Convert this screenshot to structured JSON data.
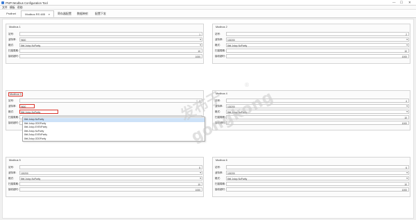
{
  "window": {
    "title": "PNPI Modbus Configuration Tool",
    "minimize": "—",
    "maximize": "☐",
    "close": "✕"
  },
  "menu": [
    "文件",
    "模板",
    "帮助"
  ],
  "tabs": [
    {
      "label": "Profinet"
    },
    {
      "label": "Modbus RS 485"
    },
    {
      "label": "寄存器配置"
    },
    {
      "label": "数据映射"
    },
    {
      "label": "配置下发"
    }
  ],
  "labels": {
    "station": "站号:",
    "baud": "波特率:",
    "format": "格式:",
    "scan": "扫描周期:",
    "timeout": "接收超时:"
  },
  "panels": [
    {
      "title": "Modbus 1",
      "station": "1",
      "baud": "9600",
      "format": "8bit-1stop-NoParity",
      "scan": "10",
      "timeout": "1000"
    },
    {
      "title": "Modbus 2",
      "station": "2",
      "baud": "115200",
      "format": "8bit-1stop-NoParity",
      "scan": "10",
      "timeout": "1000"
    },
    {
      "title": "Modbus 3",
      "station": "3",
      "baud": "9600",
      "format": "8bit-1stop-NoParity",
      "scan": "10",
      "timeout": "1000"
    },
    {
      "title": "Modbus 4",
      "station": "4",
      "baud": "115200",
      "format": "8bit-1stop-NoParity",
      "scan": "10",
      "timeout": "1000"
    },
    {
      "title": "Modbus 5",
      "station": "5",
      "baud": "115200",
      "format": "8bit-1stop-NoParity",
      "scan": "10",
      "timeout": "1000"
    },
    {
      "title": "Modbus 6",
      "station": "6",
      "baud": "115200",
      "format": "8bit-1stop-NoParity",
      "scan": "10",
      "timeout": "1000"
    }
  ],
  "dropdown_options": [
    "8bit-1stop-NoParity",
    "8bit-1stop-ODDParity",
    "8bit-1stop-EVENParity",
    "8bit-2stop-NoParity",
    "8bit-2stop-EVENParity",
    "8bit-2stop-ODDParity"
  ],
  "watermark": {
    "cn": "发布于",
    "en": "gongkong",
    "reg": "®"
  },
  "icons": {
    "dropdown": "chevron-down-icon",
    "app": "app-icon"
  }
}
